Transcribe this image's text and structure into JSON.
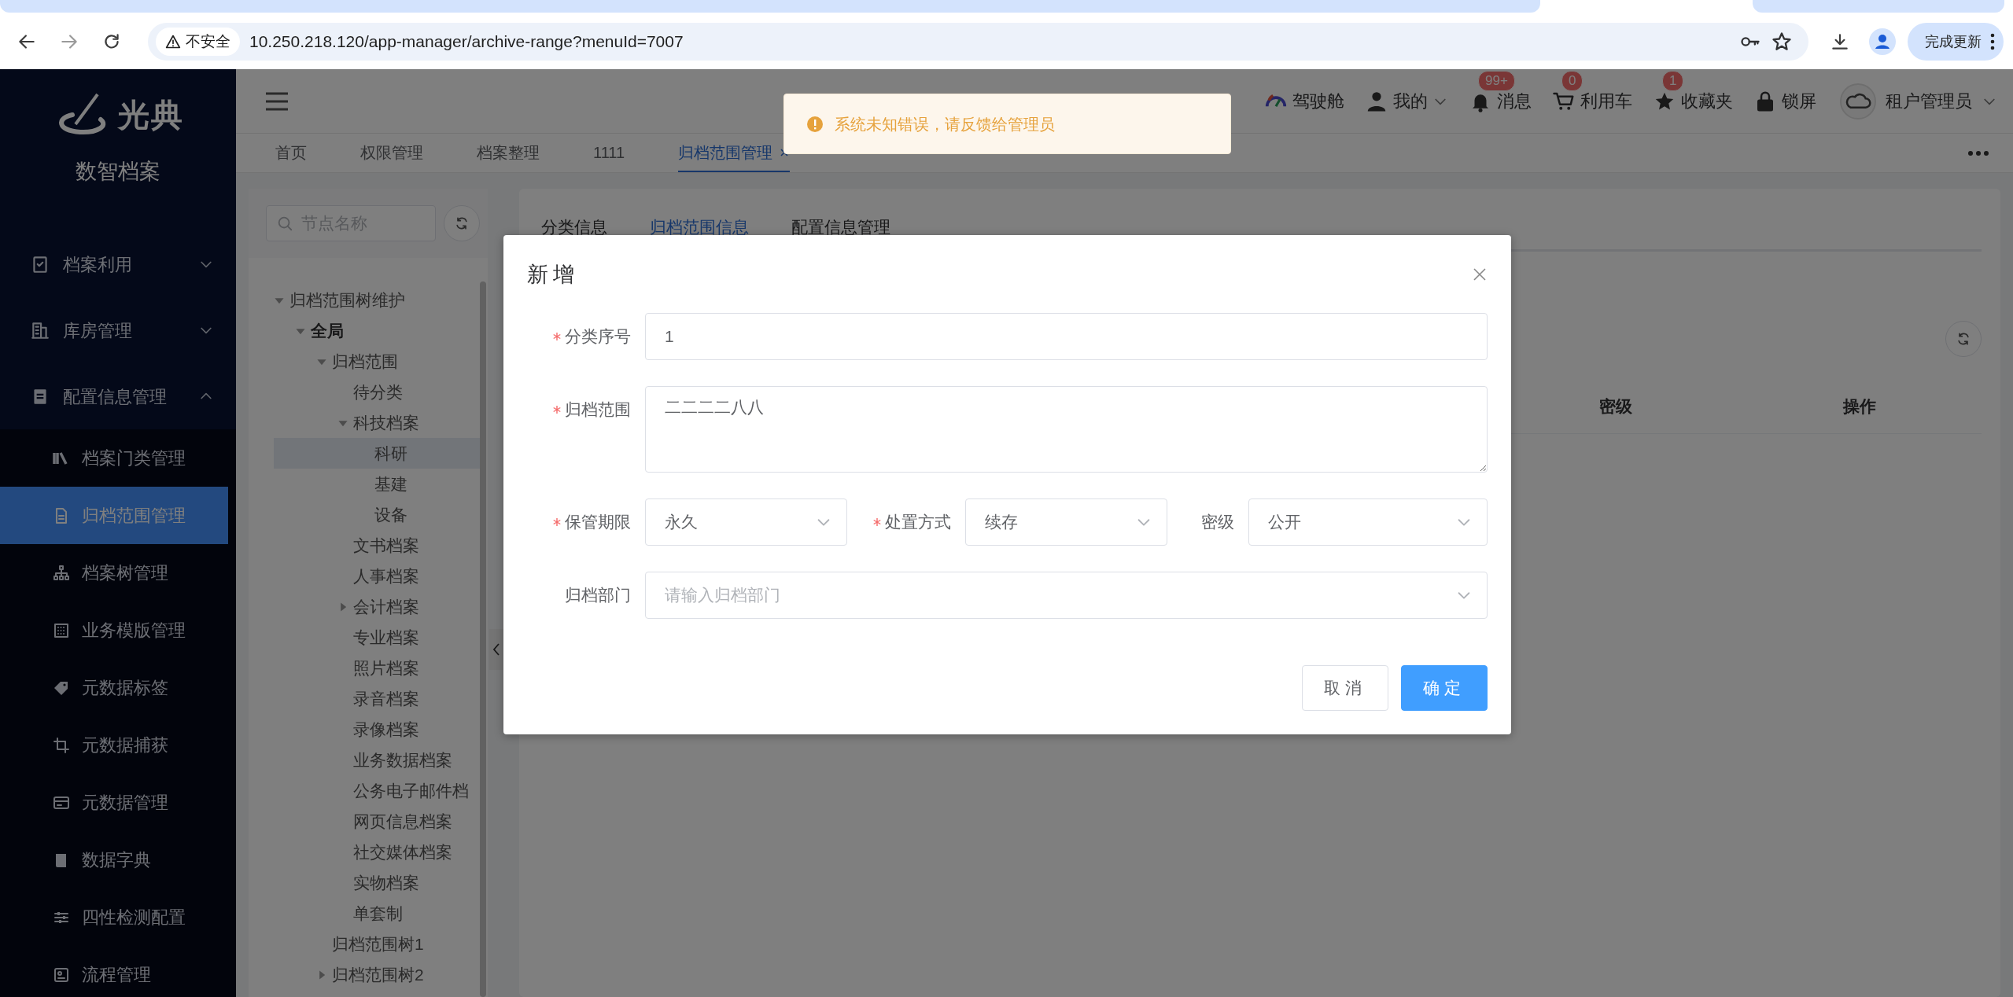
{
  "browser": {
    "security_label": "不安全",
    "url": "10.250.218.120/app-manager/archive-range?menuId=7007",
    "update_button": "完成更新"
  },
  "sidebar": {
    "logo_text": "光典",
    "app_name": "数智档案",
    "menu": [
      {
        "label": "档案利用",
        "expanded": false
      },
      {
        "label": "库房管理",
        "expanded": false
      },
      {
        "label": "配置信息管理",
        "expanded": true,
        "children": [
          {
            "label": "档案门类管理",
            "selected": false
          },
          {
            "label": "归档范围管理",
            "selected": true
          },
          {
            "label": "档案树管理",
            "selected": false
          },
          {
            "label": "业务模版管理",
            "selected": false
          },
          {
            "label": "元数据标签",
            "selected": false
          },
          {
            "label": "元数据捕获",
            "selected": false
          },
          {
            "label": "元数据管理",
            "selected": false
          },
          {
            "label": "数据字典",
            "selected": false
          },
          {
            "label": "四性检测配置",
            "selected": false
          },
          {
            "label": "流程管理",
            "selected": false
          }
        ]
      }
    ]
  },
  "header": {
    "cockpit": "驾驶舱",
    "mine": "我的",
    "messages": {
      "label": "消息",
      "badge": "99+"
    },
    "cart": {
      "label": "利用车",
      "badge": "0"
    },
    "favorites": {
      "label": "收藏夹",
      "badge": "1"
    },
    "lock": "锁屏",
    "user": "租户管理员"
  },
  "page_tabs": [
    {
      "label": "首页",
      "selected": false
    },
    {
      "label": "权限管理",
      "selected": false
    },
    {
      "label": "档案整理",
      "selected": false
    },
    {
      "label": "1111",
      "selected": false
    },
    {
      "label": "归档范围管理",
      "selected": true
    }
  ],
  "tree": {
    "search_placeholder": "节点名称",
    "nodes": [
      {
        "label": "归档范围树维护",
        "selected": false,
        "expanded": true,
        "children": [
          {
            "label": "全局",
            "bold": true,
            "selected": false,
            "expanded": true,
            "children": [
              {
                "label": "归档范围",
                "selected": false,
                "expanded": true,
                "children": [
                  {
                    "label": "待分类",
                    "selected": false
                  },
                  {
                    "label": "科技档案",
                    "selected": false,
                    "expanded": true,
                    "children": [
                      {
                        "label": "科研",
                        "selected": true
                      },
                      {
                        "label": "基建",
                        "selected": false
                      },
                      {
                        "label": "设备",
                        "selected": false
                      }
                    ]
                  },
                  {
                    "label": "文书档案",
                    "selected": false
                  },
                  {
                    "label": "人事档案",
                    "selected": false
                  },
                  {
                    "label": "会计档案",
                    "selected": false,
                    "expanded": false
                  },
                  {
                    "label": "专业档案",
                    "selected": false
                  },
                  {
                    "label": "照片档案",
                    "selected": false
                  },
                  {
                    "label": "录音档案",
                    "selected": false
                  },
                  {
                    "label": "录像档案",
                    "selected": false
                  },
                  {
                    "label": "业务数据档案",
                    "selected": false
                  },
                  {
                    "label": "公务电子邮件档",
                    "selected": false
                  },
                  {
                    "label": "网页信息档案",
                    "selected": false
                  },
                  {
                    "label": "社交媒体档案",
                    "selected": false
                  },
                  {
                    "label": "实物档案",
                    "selected": false
                  },
                  {
                    "label": "单套制",
                    "selected": false
                  }
                ]
              },
              {
                "label": "归档范围树1",
                "selected": false
              },
              {
                "label": "归档范围树2",
                "selected": false,
                "expanded": false
              }
            ]
          }
        ]
      }
    ]
  },
  "panel": {
    "tabs": [
      {
        "label": "分类信息",
        "selected": false
      },
      {
        "label": "归档范围信息",
        "selected": true
      },
      {
        "label": "配置信息管理",
        "selected": false
      }
    ],
    "table": {
      "columns": [
        "密级",
        "操作"
      ]
    }
  },
  "toast": {
    "kind": "warning",
    "message": "系统未知错误，请反馈给管理员"
  },
  "dialog": {
    "title": "新增",
    "rows": [
      [
        {
          "label": "分类序号",
          "required": true,
          "kind": "input",
          "value": "1"
        }
      ],
      [
        {
          "label": "归档范围",
          "required": true,
          "kind": "textarea",
          "value": "二二二二八八"
        }
      ],
      [
        {
          "label": "保管期限",
          "required": true,
          "kind": "select",
          "value": "永久"
        },
        {
          "label": "处置方式",
          "required": true,
          "kind": "select",
          "value": "续存"
        },
        {
          "label": "密级",
          "required": false,
          "kind": "select",
          "value": "公开"
        }
      ],
      [
        {
          "label": "归档部门",
          "required": false,
          "kind": "select",
          "placeholder": "请输入归档部门"
        }
      ]
    ],
    "buttons": [
      {
        "label": "取消",
        "kind": "default"
      },
      {
        "label": "确定",
        "kind": "primary"
      }
    ]
  }
}
